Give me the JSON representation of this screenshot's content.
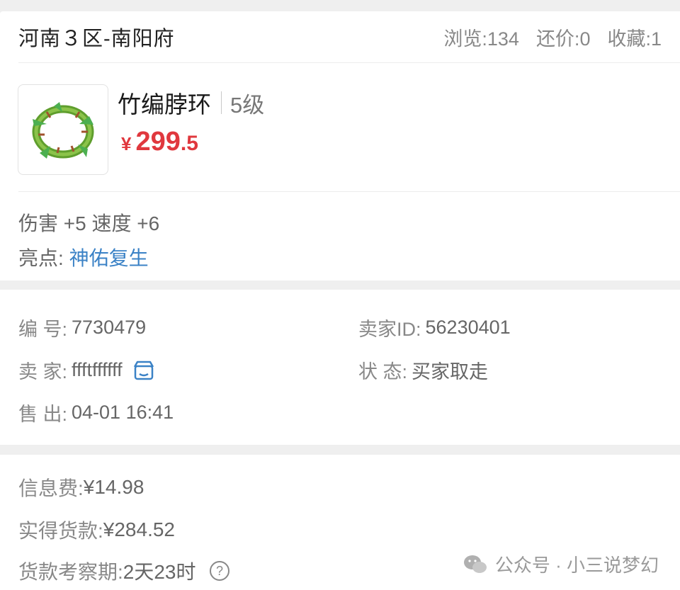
{
  "header": {
    "region": "河南３区-南阳府",
    "views": "浏览:134",
    "counter_offers": "还价:0",
    "favorites": "收藏:1"
  },
  "item": {
    "name": "竹编脖环",
    "level": "5级",
    "price_currency": "¥",
    "price_int": "299",
    "price_dec": ".5",
    "attributes": "伤害 +5 速度 +6",
    "highlight_label": "亮点:",
    "highlight_value": "神佑复生",
    "icon": "bamboo-wreath-icon"
  },
  "details": {
    "serial_label": "编  号:",
    "serial_value": "7730479",
    "seller_id_label": "卖家ID:",
    "seller_id_value": "56230401",
    "seller_label": "卖  家:",
    "seller_value": "ffftffffff",
    "status_label": "状  态:",
    "status_value": "买家取走",
    "sold_label": "售  出:",
    "sold_value": "04-01 16:41"
  },
  "fees": {
    "info_fee_label": "信息费:",
    "info_fee_value": "¥14.98",
    "net_label": "实得货款:",
    "net_value": "¥284.52",
    "period_label": "货款考察期:",
    "period_value": "2天23时"
  },
  "watermark": {
    "text": "公众号 · 小三说梦幻"
  },
  "colors": {
    "price": "#e0383e",
    "link": "#3b82c6",
    "background": "#efefef"
  }
}
